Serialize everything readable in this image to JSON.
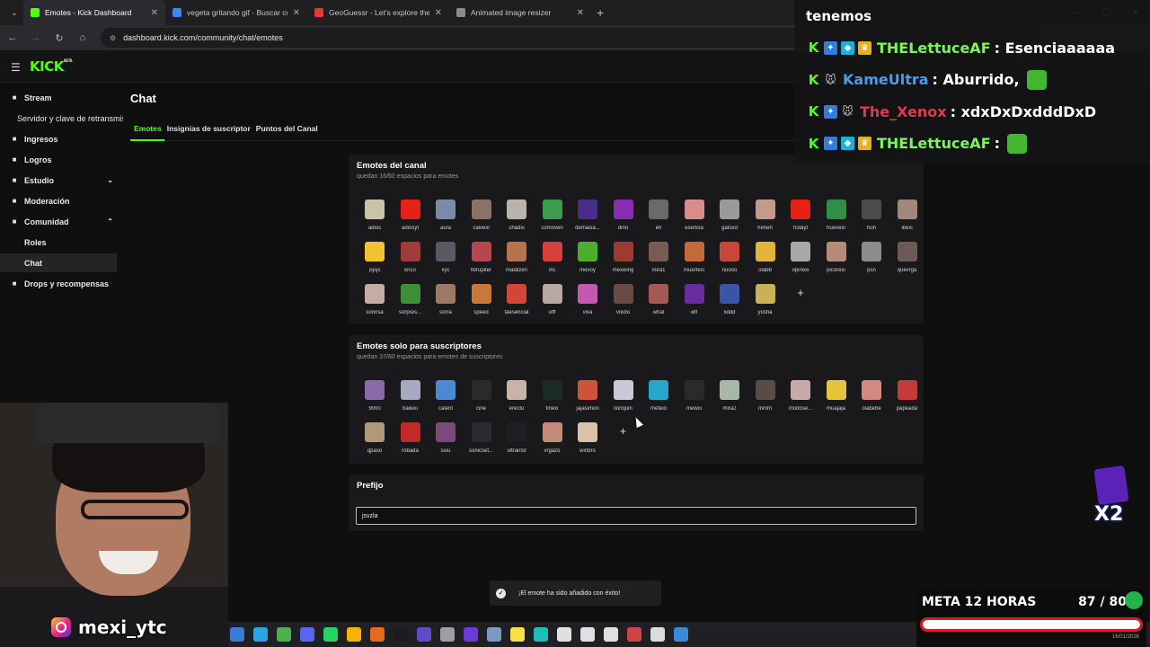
{
  "browser": {
    "tabs": [
      {
        "label": "Emotes - Kick Dashboard",
        "color": "#53fc18",
        "active": true
      },
      {
        "label": "vegeta gritando gif - Buscar con",
        "color": "#4285f4",
        "active": false
      },
      {
        "label": "GeoGuessr - Let's explore the w",
        "color": "#e53935",
        "active": false
      },
      {
        "label": "Animated image resizer",
        "color": "#8c8c8c",
        "active": false
      }
    ],
    "url": "dashboard.kick.com/community/chat/emotes"
  },
  "app": {
    "logo": "KICK",
    "logo_tag": "BETA"
  },
  "sidebar": {
    "items": [
      {
        "label": "Stream",
        "icon": "broadcast-icon"
      },
      {
        "label": "Servidor y clave de retransmisión",
        "sub": true
      },
      {
        "label": "Ingresos",
        "icon": "money-icon"
      },
      {
        "label": "Logros",
        "icon": "trophy-icon"
      },
      {
        "label": "Estudio",
        "icon": "studio-icon",
        "chevron": "down"
      },
      {
        "label": "Moderación",
        "icon": "wrench-icon"
      },
      {
        "label": "Comunidad",
        "icon": "community-icon",
        "chevron": "up"
      },
      {
        "label": "Roles",
        "sub": true
      },
      {
        "label": "Chat",
        "sub": true,
        "active": true
      },
      {
        "label": "Drops y recompensas",
        "icon": "gift-icon"
      }
    ]
  },
  "main": {
    "title": "Chat",
    "tabs": [
      "Emotes",
      "Insignias de suscriptor",
      "Puntos del Canal"
    ],
    "channel_emotes": {
      "title": "Emotes del canal",
      "subtitle": "quedan 16/60 espacios para emotes",
      "emotes": [
        {
          "name": "adios",
          "color": "#c9c3a8"
        },
        {
          "name": "adiosyt",
          "color": "#e62117"
        },
        {
          "name": "aura",
          "color": "#7a8aa8"
        },
        {
          "name": "calvexi",
          "color": "#8a7266"
        },
        {
          "name": "chadxi",
          "color": "#b9b2ad"
        },
        {
          "name": "comoven",
          "color": "#3c9b4e"
        },
        {
          "name": "demasia...",
          "color": "#4a2d8a"
        },
        {
          "name": "dino",
          "color": "#8a2bb5"
        },
        {
          "name": "eh",
          "color": "#6a6a6a"
        },
        {
          "name": "esencia",
          "color": "#d98c8c"
        },
        {
          "name": "gatoxd",
          "color": "#9a9a9a"
        },
        {
          "name": "heheh",
          "color": "#c49a8a"
        },
        {
          "name": "holayt",
          "color": "#e62117"
        },
        {
          "name": "huevexi",
          "color": "#2f8f44"
        },
        {
          "name": "huh",
          "color": "#4c4c4c"
        },
        {
          "name": "ibexi",
          "color": "#a3877a"
        },
        {
          "name": "jsjsjs",
          "color": "#f1c232"
        },
        {
          "name": "krico",
          "color": "#a33a3a"
        },
        {
          "name": "kyc",
          "color": "#5a5a66"
        },
        {
          "name": "llorupiter",
          "color": "#b8454f"
        },
        {
          "name": "maldizen",
          "color": "#b5744c"
        },
        {
          "name": "mc",
          "color": "#d7403a"
        },
        {
          "name": "mevoy",
          "color": "#4cae2c"
        },
        {
          "name": "mexwing",
          "color": "#9e3a2f"
        },
        {
          "name": "mira1",
          "color": "#7a5a55"
        },
        {
          "name": "muertexi",
          "color": "#c26a3a"
        },
        {
          "name": "nuooo",
          "color": "#c9463a"
        },
        {
          "name": "olabb",
          "color": "#e2b43a"
        },
        {
          "name": "opinexi",
          "color": "#a8a8a8"
        },
        {
          "name": "picorexi",
          "color": "#b58a78"
        },
        {
          "name": "psn",
          "color": "#8c8c8c"
        },
        {
          "name": "quevrga",
          "color": "#6e5a55"
        },
        {
          "name": "sonrisa",
          "color": "#c6aca2"
        },
        {
          "name": "sorpres...",
          "color": "#3f8f3a"
        },
        {
          "name": "sorra",
          "color": "#9e7a66"
        },
        {
          "name": "speed",
          "color": "#c9783a"
        },
        {
          "name": "taesencial",
          "color": "#d0463a"
        },
        {
          "name": "ufff",
          "color": "#b9a8a2"
        },
        {
          "name": "viva",
          "color": "#c45ab0"
        },
        {
          "name": "voidxi",
          "color": "#6a4a42"
        },
        {
          "name": "what",
          "color": "#a35a55"
        },
        {
          "name": "wtf",
          "color": "#6a2aa0"
        },
        {
          "name": "xddd",
          "color": "#3a55a8"
        },
        {
          "name": "yosha",
          "color": "#c9b05a"
        }
      ]
    },
    "sub_emotes": {
      "title": "Emotes solo para suscriptores",
      "subtitle": "quedan 37/60 espacios para emotes de suscriptores",
      "emotes": [
        {
          "name": "9000",
          "color": "#8a6aa8"
        },
        {
          "name": "bailexi",
          "color": "#a8a8c0"
        },
        {
          "name": "calent",
          "color": "#4a8ad0"
        },
        {
          "name": "cine",
          "color": "#2a2a2a"
        },
        {
          "name": "erecto",
          "color": "#c9b2a8"
        },
        {
          "name": "finexi",
          "color": "#1c2a24"
        },
        {
          "name": "jajasimon",
          "color": "#d0523a"
        },
        {
          "name": "lloriquin",
          "color": "#c9c9d6"
        },
        {
          "name": "meteio",
          "color": "#28a6c9"
        },
        {
          "name": "mewxi",
          "color": "#2a2a2a"
        },
        {
          "name": "mira2",
          "color": "#a8b8a8"
        },
        {
          "name": "mmm",
          "color": "#5a4a48"
        },
        {
          "name": "modose...",
          "color": "#c9a8a8"
        },
        {
          "name": "muajaja",
          "color": "#e6c43a"
        },
        {
          "name": "olabebe",
          "color": "#d08a80"
        },
        {
          "name": "papeada",
          "color": "#c23a3a"
        },
        {
          "name": "qpaso",
          "color": "#b0987a"
        },
        {
          "name": "robada",
          "color": "#c22a2a"
        },
        {
          "name": "siuu",
          "color": "#7a4a7a"
        },
        {
          "name": "sonicset...",
          "color": "#2a2a34"
        },
        {
          "name": "ultrainst",
          "color": "#1e1e24"
        },
        {
          "name": "vrgazo",
          "color": "#c48a7a"
        },
        {
          "name": "winbro",
          "color": "#d8c2a8"
        }
      ]
    },
    "prefix": {
      "title": "Prefijo",
      "value": "jsvzla"
    },
    "toast": "¡El emote ha sido añadido con éxito!"
  },
  "overlay": {
    "chat_header": "tenemos",
    "chat_lines": [
      {
        "user": "THELettuceAF",
        "message": ": Esenciaaaaaa",
        "color": "user-g",
        "badges": [
          "kick",
          "blue",
          "cube",
          "crown"
        ],
        "emote": false
      },
      {
        "user": "KameUltra",
        "message": ": Aburrido,",
        "color": "user-b",
        "badges": [
          "kick",
          "mouse"
        ],
        "emote": true
      },
      {
        "user": "The_Xenox",
        "message": ": xdxDxDxdddDxD",
        "color": "user-r",
        "badges": [
          "kick",
          "blue",
          "mouse"
        ],
        "emote": false
      },
      {
        "user": "THELettuceAF",
        "message": ":",
        "color": "user-g",
        "badges": [
          "kick",
          "blue",
          "cube",
          "crown"
        ],
        "emote": true
      }
    ],
    "instagram": "mexi_ytc",
    "multiplier": "X2",
    "goal_label": "META 12 HORAS",
    "goal_value": "87 / 80",
    "goal_progress": 1.0,
    "goal_date": "16/01/2026"
  }
}
